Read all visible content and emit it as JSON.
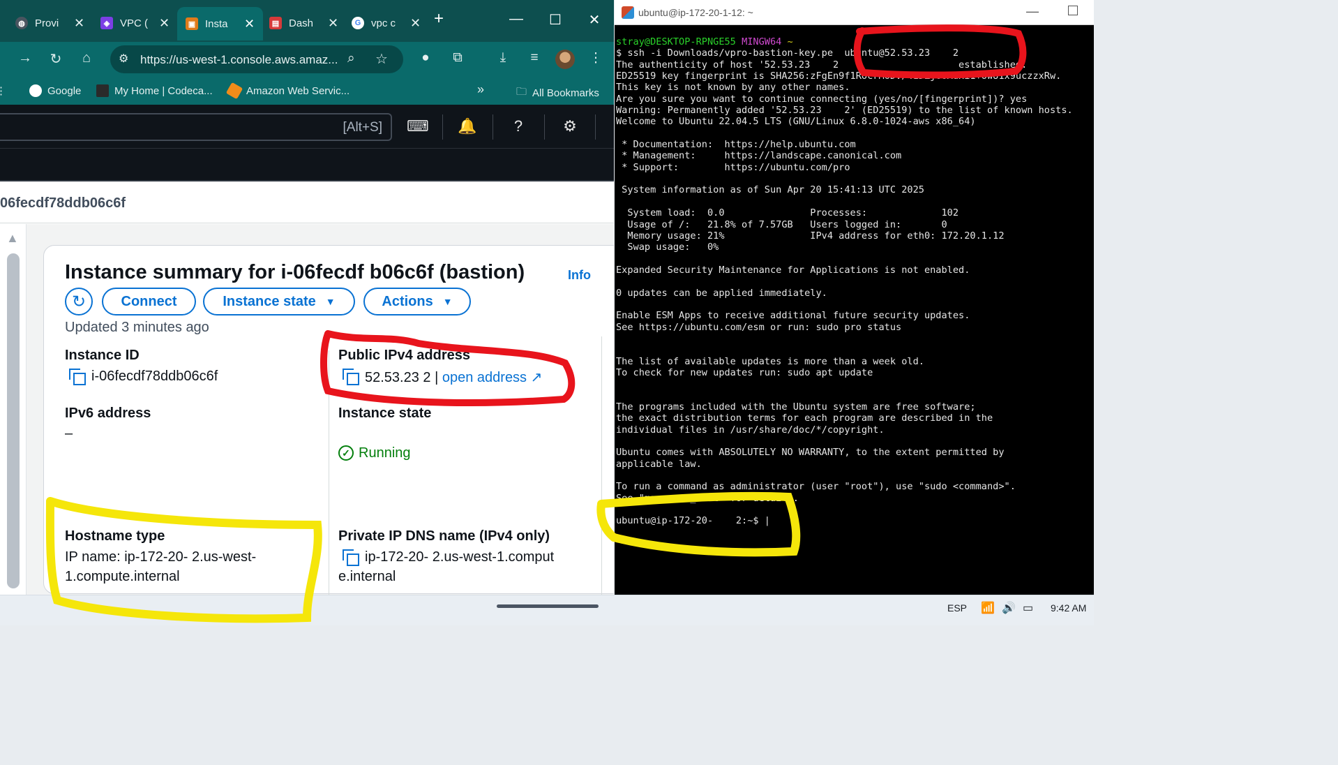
{
  "browser": {
    "tabs": [
      {
        "label": "Provi",
        "icon": "globe-icon",
        "color": "#4a5560"
      },
      {
        "label": "VPC (",
        "icon": "vpc-icon",
        "color": "#7b3fe4"
      },
      {
        "label": "Insta",
        "icon": "ec2-icon",
        "color": "#e07b1a"
      },
      {
        "label": "Dash",
        "icon": "dashboard-icon",
        "color": "#d63a3a"
      },
      {
        "label": "vpc c",
        "icon": "google-icon",
        "color": "#ffffff"
      }
    ],
    "new_tab": "+",
    "url": "https://us-west-1.console.aws.amaz...",
    "bookmarks": {
      "google": "Google",
      "codecademy": "My Home | Codeca...",
      "aws": "Amazon Web Servic...",
      "overflow": "»",
      "all": "All Bookmarks"
    }
  },
  "aws": {
    "search_hint": "[Alt+S]",
    "breadcrumb": "06fecdf78ddb06c6f",
    "card": {
      "title": "Instance summary for i-06fecdf          b06c6f (bastion)",
      "info": "Info",
      "connect": "Connect",
      "instance_state_btn": "Instance state",
      "actions_btn": "Actions",
      "updated": "Updated 3 minutes ago",
      "instance_id_label": "Instance ID",
      "instance_id": "i-06fecdf78ddb06c6f",
      "public_ipv4_label": "Public IPv4 address",
      "public_ipv4": "52.53.23       2",
      "public_ipv4_sep": "|",
      "open_address": "open address",
      "ipv6_label": "IPv6 address",
      "ipv6_value": "–",
      "instance_state_label": "Instance state",
      "instance_state": "Running",
      "hostname_label": "Hostname type",
      "hostname_line1": "IP name: ip-172-20-       2.us-west-",
      "hostname_line2": "1.compute.internal",
      "private_dns_label": "Private IP DNS name (IPv4 only)",
      "private_dns_line1": "ip-172-20-       2.us-west-1.comput",
      "private_dns_line2": "e.internal"
    }
  },
  "terminal": {
    "title": "ubuntu@ip-172-20-1-12: ~",
    "lines": [
      "",
      "$ ssh -i Downloads/vpro-bastion-key.pe  ubuntu@52.53.23    2",
      "The authenticity of host '52.53.23    2                     established.",
      "ED25519 key fingerprint is SHA256:zFgEn9f1RocrM6DV/41DZj6oXdHi1+owU1x9uczzxRw.",
      "This key is not known by any other names.",
      "Are you sure you want to continue connecting (yes/no/[fingerprint])? yes",
      "Warning: Permanently added '52.53.23    2' (ED25519) to the list of known hosts.",
      "Welcome to Ubuntu 22.04.5 LTS (GNU/Linux 6.8.0-1024-aws x86_64)",
      "",
      " * Documentation:  https://help.ubuntu.com",
      " * Management:     https://landscape.canonical.com",
      " * Support:        https://ubuntu.com/pro",
      "",
      " System information as of Sun Apr 20 15:41:13 UTC 2025",
      "",
      "  System load:  0.0               Processes:             102",
      "  Usage of /:   21.8% of 7.57GB   Users logged in:       0",
      "  Memory usage: 21%               IPv4 address for eth0: 172.20.1.12",
      "  Swap usage:   0%",
      "",
      "Expanded Security Maintenance for Applications is not enabled.",
      "",
      "0 updates can be applied immediately.",
      "",
      "Enable ESM Apps to receive additional future security updates.",
      "See https://ubuntu.com/esm or run: sudo pro status",
      "",
      "",
      "The list of available updates is more than a week old.",
      "To check for new updates run: sudo apt update",
      "",
      "",
      "The programs included with the Ubuntu system are free software;",
      "the exact distribution terms for each program are described in the",
      "individual files in /usr/share/doc/*/copyright.",
      "",
      "Ubuntu comes with ABSOLUTELY NO WARRANTY, to the extent permitted by",
      "applicable law.",
      "",
      "To run a command as administrator (user \"root\"), use \"sudo <command>\".",
      "See \"man sudo_root\" for details.",
      "",
      "ubuntu@ip-172-20-    2:~$ |"
    ],
    "prompt_line": {
      "user": "stray@DESKTOP-RPNGE55",
      "env": "MINGW64",
      "dir": "~"
    }
  },
  "taskbar": {
    "lang": "ESP",
    "time": "9:42 AM"
  },
  "colors": {
    "tab_bg": "#0d4f4f",
    "toolbar_bg": "#0a6a6a",
    "aws_nav": "#0f141a",
    "aws_blue": "#0972d3",
    "running_green": "#037f0c",
    "annotation_red": "#e8141c",
    "annotation_yellow": "#f5e60a"
  }
}
